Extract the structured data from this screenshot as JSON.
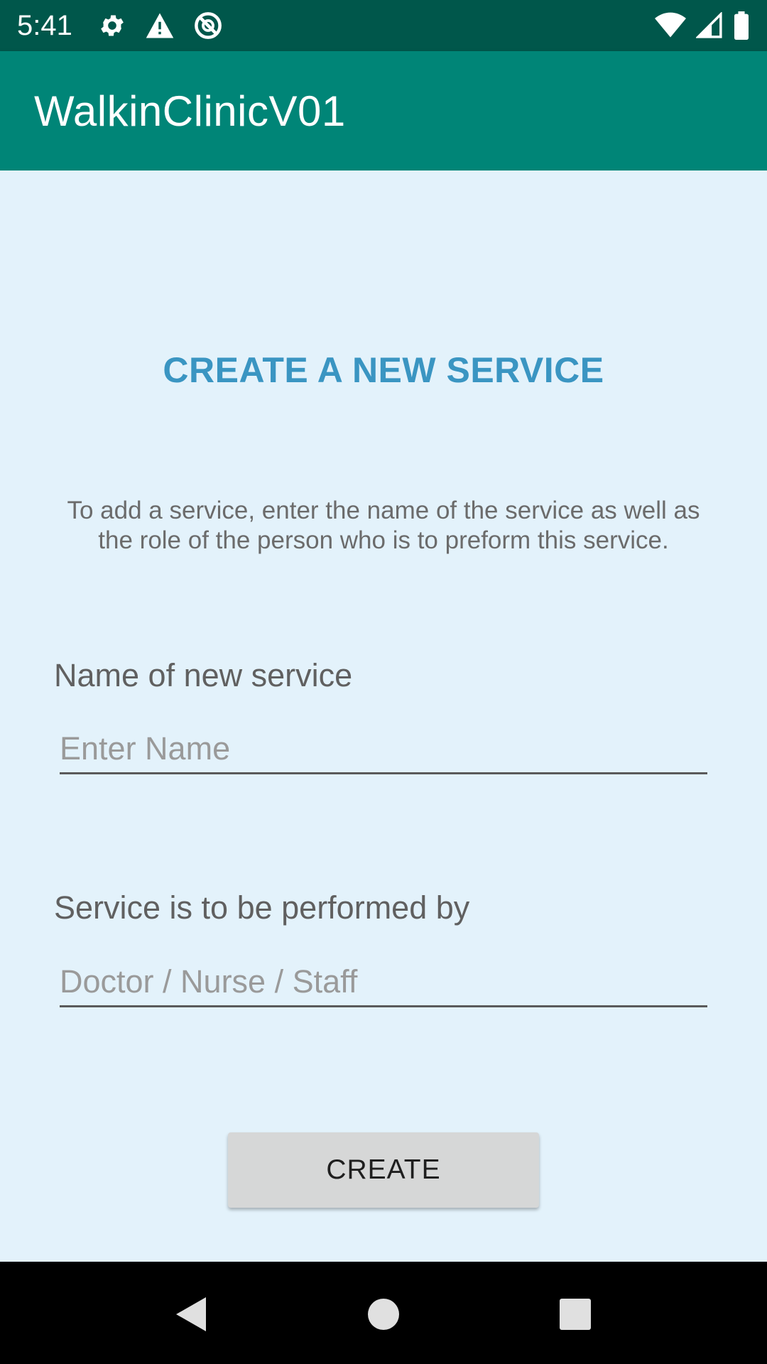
{
  "status_bar": {
    "time": "5:41",
    "icons_left": [
      "settings-icon",
      "warning-icon",
      "no-sync-icon"
    ],
    "icons_right": [
      "wifi-icon",
      "cell-signal-icon",
      "battery-icon"
    ]
  },
  "app_bar": {
    "title": "WalkinClinicV01",
    "color": "#008577"
  },
  "main": {
    "heading": "CREATE A NEW SERVICE",
    "instructions": "To add a service, enter the name of the service as well as the role of the person who is to preform this service.",
    "name_field": {
      "label": "Name of new service",
      "placeholder": "Enter Name",
      "value": ""
    },
    "role_field": {
      "label": "Service is to be performed by",
      "placeholder": "Doctor / Nurse / Staff",
      "value": ""
    },
    "create_button": "CREATE"
  },
  "nav_bar": {
    "icons": [
      "back-icon",
      "home-icon",
      "recents-icon"
    ]
  },
  "colors": {
    "status_bar": "#00574b",
    "app_bar": "#008577",
    "background": "#e3f2fb",
    "heading": "#3a95c2",
    "button": "#d6d7d7"
  }
}
